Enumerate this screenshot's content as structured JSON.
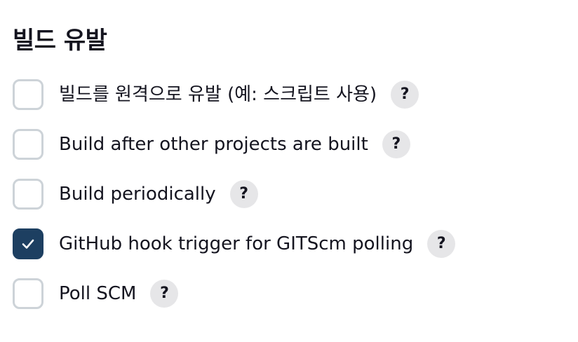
{
  "section": {
    "title": "빌드 유발"
  },
  "options": [
    {
      "label": "빌드를 원격으로 유발 (예: 스크립트 사용)",
      "checked": false,
      "help": "?"
    },
    {
      "label": "Build after other projects are built",
      "checked": false,
      "help": "?"
    },
    {
      "label": "Build periodically",
      "checked": false,
      "help": "?"
    },
    {
      "label": "GitHub hook trigger for GITScm polling",
      "checked": true,
      "help": "?"
    },
    {
      "label": "Poll SCM",
      "checked": false,
      "help": "?"
    }
  ],
  "icons": {
    "checked": "checkmark-icon",
    "help": "question-mark-icon"
  },
  "colors": {
    "checked_fill": "#1d3f61",
    "unchecked_border": "#cdd3d8",
    "help_bg": "#e6e6e8",
    "text": "#14141f"
  }
}
